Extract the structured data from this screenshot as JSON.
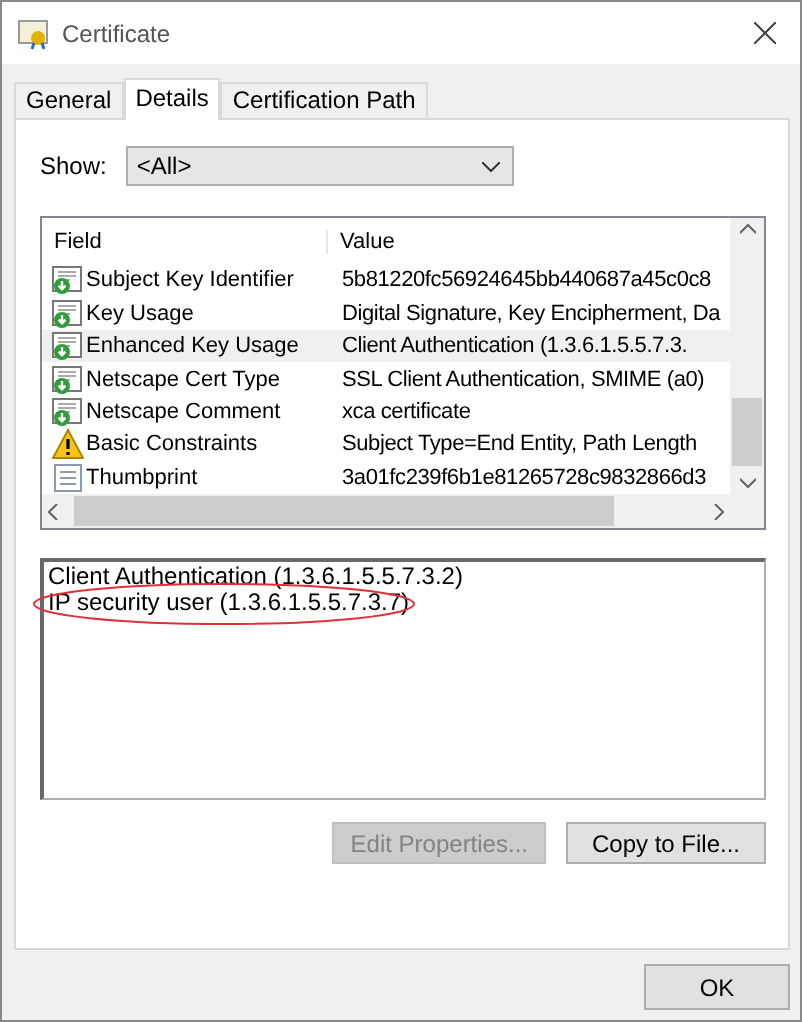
{
  "window": {
    "title": "Certificate"
  },
  "tabs": [
    {
      "label": "General",
      "selected": false
    },
    {
      "label": "Details",
      "selected": true
    },
    {
      "label": "Certification Path",
      "selected": false
    }
  ],
  "show": {
    "label": "Show:",
    "value": "<All>"
  },
  "table": {
    "columns": [
      "Field",
      "Value"
    ],
    "rows": [
      {
        "field": "Subject Key Identifier",
        "value": "5b81220fc56924645bb440687a45c0c8",
        "kind": "extension",
        "selected": false
      },
      {
        "field": "Key Usage",
        "value": "Digital Signature, Key Encipherment, Da",
        "kind": "extension",
        "selected": false
      },
      {
        "field": "Enhanced Key Usage",
        "value": "Client Authentication (1.3.6.1.5.5.7.3.",
        "kind": "extension",
        "selected": true
      },
      {
        "field": "Netscape Cert Type",
        "value": "SSL Client Authentication, SMIME (a0)",
        "kind": "extension",
        "selected": false
      },
      {
        "field": "Netscape Comment",
        "value": "xca certificate",
        "kind": "extension",
        "selected": false
      },
      {
        "field": "Basic Constraints",
        "value": "Subject Type=End Entity, Path Length",
        "kind": "warning",
        "selected": false
      },
      {
        "field": "Thumbprint",
        "value": "3a01fc239f6b1e81265728c9832866d3",
        "kind": "property",
        "selected": false
      }
    ]
  },
  "detail_lines": [
    {
      "text": "Client Authentication (1.3.6.1.5.5.7.3.2)",
      "circled": false
    },
    {
      "text": "IP security user (1.3.6.1.5.5.7.3.7)",
      "circled": true
    }
  ],
  "buttons": [
    {
      "label": "Edit Properties...",
      "disabled": true
    },
    {
      "label": "Copy to File...",
      "disabled": false
    }
  ],
  "footer_button": "OK"
}
